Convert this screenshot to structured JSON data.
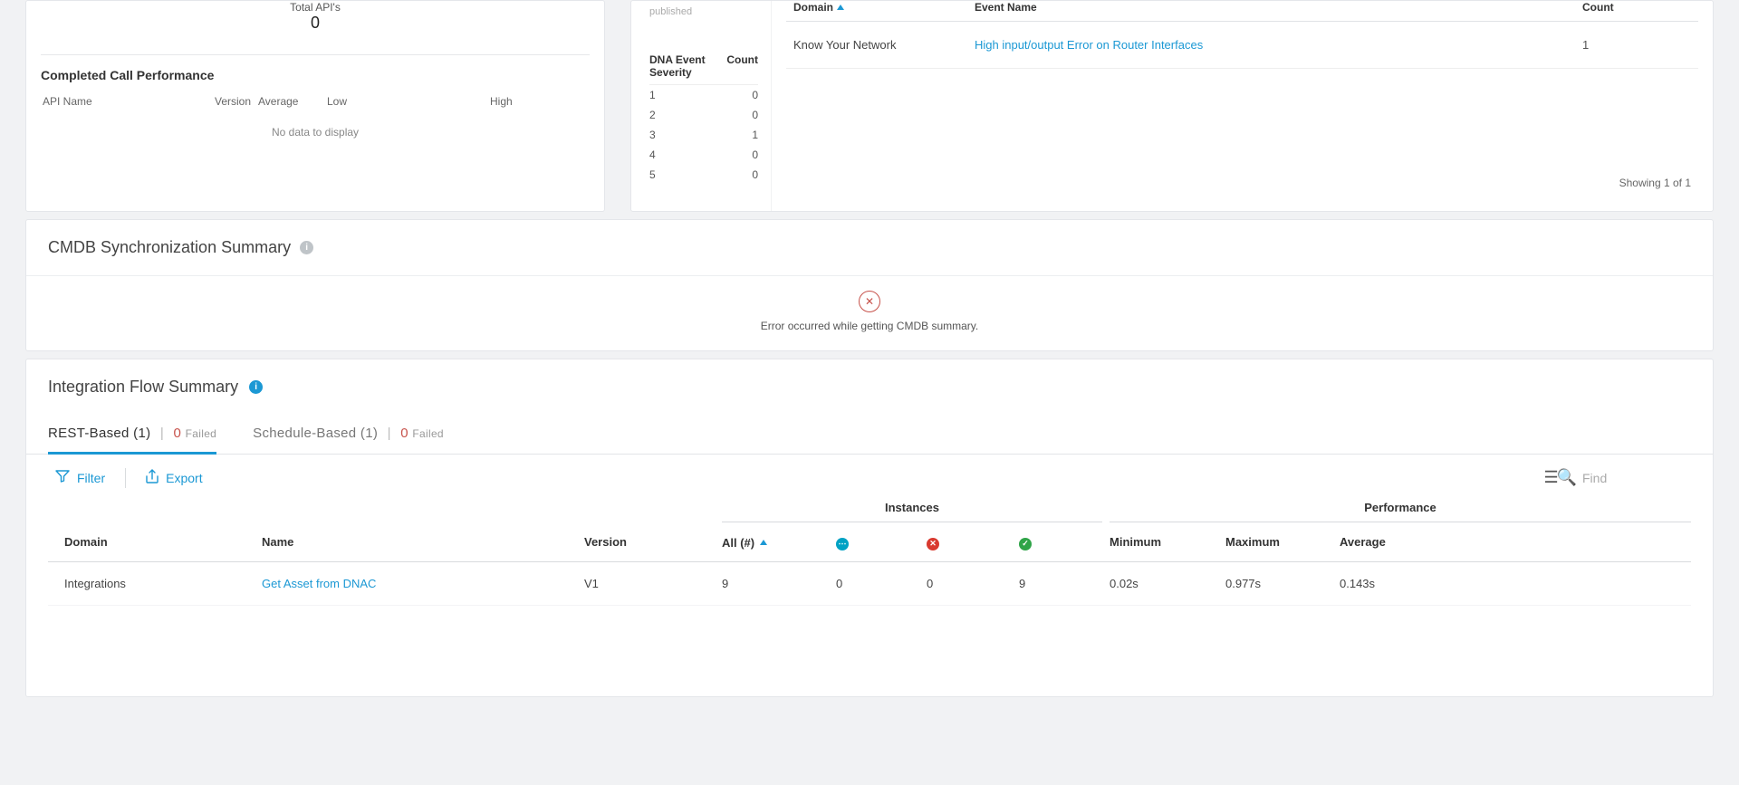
{
  "top_left": {
    "total_label": "Total API's",
    "total_value": "0",
    "completed_title": "Completed Call Performance",
    "headers": {
      "name": "API Name",
      "version": "Version",
      "average": "Average",
      "low": "Low",
      "high": "High"
    },
    "no_data": "No data to display"
  },
  "top_right": {
    "published_label": "published",
    "severity_header": {
      "name": "DNA Event Severity",
      "count": "Count"
    },
    "severity_rows": [
      {
        "sev": "1",
        "count": "0"
      },
      {
        "sev": "2",
        "count": "0"
      },
      {
        "sev": "3",
        "count": "1"
      },
      {
        "sev": "4",
        "count": "0"
      },
      {
        "sev": "5",
        "count": "0"
      }
    ],
    "events_header": {
      "domain": "Domain",
      "name": "Event Name",
      "count": "Count"
    },
    "events_rows": [
      {
        "domain": "Know Your Network",
        "name": "High input/output Error on Router Interfaces",
        "count": "1"
      }
    ],
    "showing": "Showing 1 of 1"
  },
  "cmdb": {
    "title": "CMDB Synchronization Summary",
    "error": "Error occurred while getting CMDB summary."
  },
  "flow": {
    "title": "Integration Flow Summary",
    "tabs": {
      "rest": {
        "label": "REST-Based (1)",
        "failnum": "0",
        "failtxt": "Failed"
      },
      "sched": {
        "label": "Schedule-Based (1)",
        "failnum": "0",
        "failtxt": "Failed"
      }
    },
    "toolbar": {
      "filter": "Filter",
      "export": "Export",
      "find_placeholder": "Find"
    },
    "group_headers": {
      "instances": "Instances",
      "performance": "Performance"
    },
    "cols": {
      "domain": "Domain",
      "name": "Name",
      "version": "Version",
      "all": "All (#)",
      "min": "Minimum",
      "max": "Maximum",
      "avg": "Average"
    },
    "rows": [
      {
        "domain": "Integrations",
        "name": "Get Asset from DNAC",
        "version": "V1",
        "all": "9",
        "i1": "0",
        "i2": "0",
        "i3": "9",
        "min": "0.02s",
        "max": "0.977s",
        "avg": "0.143s"
      }
    ]
  }
}
